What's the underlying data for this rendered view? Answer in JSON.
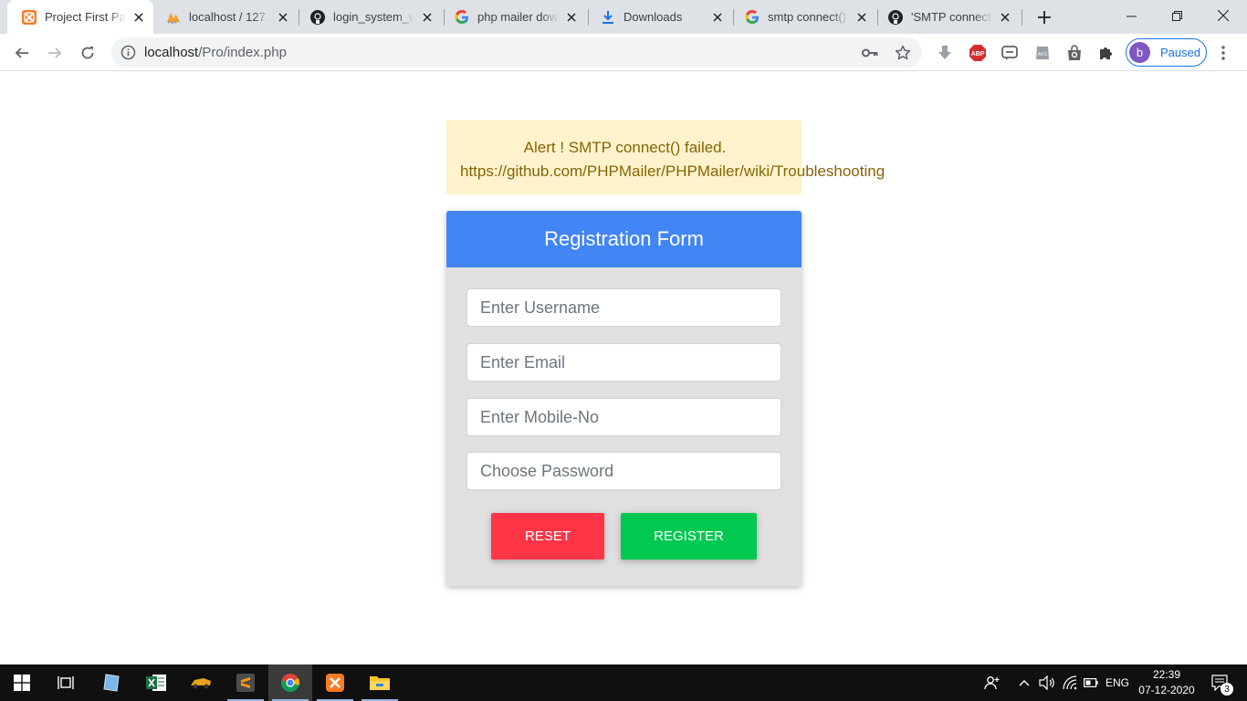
{
  "browser": {
    "tabs": [
      {
        "title": "Project First Pa",
        "icon": "xampp-icon",
        "active": true
      },
      {
        "title": "localhost / 127.",
        "icon": "phpmyadmin-icon",
        "active": false
      },
      {
        "title": "login_system_w",
        "icon": "github-icon",
        "active": false
      },
      {
        "title": "php mailer dow",
        "icon": "google-icon",
        "active": false
      },
      {
        "title": "Downloads",
        "icon": "download-icon",
        "active": false
      },
      {
        "title": "smtp connect()",
        "icon": "google-icon",
        "active": false
      },
      {
        "title": "'SMTP connect",
        "icon": "github-icon",
        "active": false
      }
    ],
    "address_bar": {
      "host": "localhost",
      "path": "/Pro/index.php"
    },
    "profile": {
      "initial": "b",
      "status": "Paused"
    },
    "extensions": [
      "download-ext-icon",
      "adblock-plus-icon",
      "chat-ext-icon",
      "avg-icon",
      "shopping-bag-icon",
      "puzzle-icon"
    ]
  },
  "page": {
    "alert": {
      "line1": "Alert ! SMTP connect() failed.",
      "line2": "https://github.com/PHPMailer/PHPMailer/wiki/Troubleshooting"
    },
    "form": {
      "title": "Registration Form",
      "username_placeholder": "Enter Username",
      "email_placeholder": "Enter Email",
      "mobile_placeholder": "Enter Mobile-No",
      "password_placeholder": "Choose Password",
      "reset_label": "RESET",
      "register_label": "REGISTER"
    },
    "colors": {
      "header": "#4285f4",
      "reset": "#ff3547",
      "register": "#00c851",
      "alert_bg": "#fff3cd",
      "alert_text": "#856404"
    }
  },
  "taskbar": {
    "apps": [
      "windows-start-icon",
      "task-view-icon",
      "notepad-app-icon",
      "excel-app-icon",
      "car-app-icon",
      "sublime-text-icon",
      "chrome-icon",
      "xampp-icon",
      "file-explorer-icon"
    ],
    "language": "ENG",
    "time": "22:39",
    "date": "07-12-2020",
    "notification_count": "3"
  }
}
